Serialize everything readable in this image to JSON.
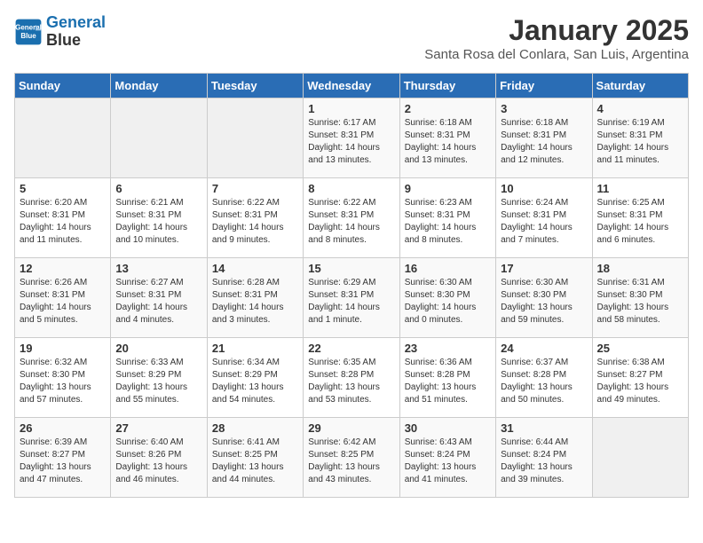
{
  "header": {
    "logo_line1": "General",
    "logo_line2": "Blue",
    "month": "January 2025",
    "location": "Santa Rosa del Conlara, San Luis, Argentina"
  },
  "days_of_week": [
    "Sunday",
    "Monday",
    "Tuesday",
    "Wednesday",
    "Thursday",
    "Friday",
    "Saturday"
  ],
  "weeks": [
    [
      {
        "day": "",
        "content": ""
      },
      {
        "day": "",
        "content": ""
      },
      {
        "day": "",
        "content": ""
      },
      {
        "day": "1",
        "content": "Sunrise: 6:17 AM\nSunset: 8:31 PM\nDaylight: 14 hours\nand 13 minutes."
      },
      {
        "day": "2",
        "content": "Sunrise: 6:18 AM\nSunset: 8:31 PM\nDaylight: 14 hours\nand 13 minutes."
      },
      {
        "day": "3",
        "content": "Sunrise: 6:18 AM\nSunset: 8:31 PM\nDaylight: 14 hours\nand 12 minutes."
      },
      {
        "day": "4",
        "content": "Sunrise: 6:19 AM\nSunset: 8:31 PM\nDaylight: 14 hours\nand 11 minutes."
      }
    ],
    [
      {
        "day": "5",
        "content": "Sunrise: 6:20 AM\nSunset: 8:31 PM\nDaylight: 14 hours\nand 11 minutes."
      },
      {
        "day": "6",
        "content": "Sunrise: 6:21 AM\nSunset: 8:31 PM\nDaylight: 14 hours\nand 10 minutes."
      },
      {
        "day": "7",
        "content": "Sunrise: 6:22 AM\nSunset: 8:31 PM\nDaylight: 14 hours\nand 9 minutes."
      },
      {
        "day": "8",
        "content": "Sunrise: 6:22 AM\nSunset: 8:31 PM\nDaylight: 14 hours\nand 8 minutes."
      },
      {
        "day": "9",
        "content": "Sunrise: 6:23 AM\nSunset: 8:31 PM\nDaylight: 14 hours\nand 8 minutes."
      },
      {
        "day": "10",
        "content": "Sunrise: 6:24 AM\nSunset: 8:31 PM\nDaylight: 14 hours\nand 7 minutes."
      },
      {
        "day": "11",
        "content": "Sunrise: 6:25 AM\nSunset: 8:31 PM\nDaylight: 14 hours\nand 6 minutes."
      }
    ],
    [
      {
        "day": "12",
        "content": "Sunrise: 6:26 AM\nSunset: 8:31 PM\nDaylight: 14 hours\nand 5 minutes."
      },
      {
        "day": "13",
        "content": "Sunrise: 6:27 AM\nSunset: 8:31 PM\nDaylight: 14 hours\nand 4 minutes."
      },
      {
        "day": "14",
        "content": "Sunrise: 6:28 AM\nSunset: 8:31 PM\nDaylight: 14 hours\nand 3 minutes."
      },
      {
        "day": "15",
        "content": "Sunrise: 6:29 AM\nSunset: 8:31 PM\nDaylight: 14 hours\nand 1 minute."
      },
      {
        "day": "16",
        "content": "Sunrise: 6:30 AM\nSunset: 8:30 PM\nDaylight: 14 hours\nand 0 minutes."
      },
      {
        "day": "17",
        "content": "Sunrise: 6:30 AM\nSunset: 8:30 PM\nDaylight: 13 hours\nand 59 minutes."
      },
      {
        "day": "18",
        "content": "Sunrise: 6:31 AM\nSunset: 8:30 PM\nDaylight: 13 hours\nand 58 minutes."
      }
    ],
    [
      {
        "day": "19",
        "content": "Sunrise: 6:32 AM\nSunset: 8:30 PM\nDaylight: 13 hours\nand 57 minutes."
      },
      {
        "day": "20",
        "content": "Sunrise: 6:33 AM\nSunset: 8:29 PM\nDaylight: 13 hours\nand 55 minutes."
      },
      {
        "day": "21",
        "content": "Sunrise: 6:34 AM\nSunset: 8:29 PM\nDaylight: 13 hours\nand 54 minutes."
      },
      {
        "day": "22",
        "content": "Sunrise: 6:35 AM\nSunset: 8:28 PM\nDaylight: 13 hours\nand 53 minutes."
      },
      {
        "day": "23",
        "content": "Sunrise: 6:36 AM\nSunset: 8:28 PM\nDaylight: 13 hours\nand 51 minutes."
      },
      {
        "day": "24",
        "content": "Sunrise: 6:37 AM\nSunset: 8:28 PM\nDaylight: 13 hours\nand 50 minutes."
      },
      {
        "day": "25",
        "content": "Sunrise: 6:38 AM\nSunset: 8:27 PM\nDaylight: 13 hours\nand 49 minutes."
      }
    ],
    [
      {
        "day": "26",
        "content": "Sunrise: 6:39 AM\nSunset: 8:27 PM\nDaylight: 13 hours\nand 47 minutes."
      },
      {
        "day": "27",
        "content": "Sunrise: 6:40 AM\nSunset: 8:26 PM\nDaylight: 13 hours\nand 46 minutes."
      },
      {
        "day": "28",
        "content": "Sunrise: 6:41 AM\nSunset: 8:25 PM\nDaylight: 13 hours\nand 44 minutes."
      },
      {
        "day": "29",
        "content": "Sunrise: 6:42 AM\nSunset: 8:25 PM\nDaylight: 13 hours\nand 43 minutes."
      },
      {
        "day": "30",
        "content": "Sunrise: 6:43 AM\nSunset: 8:24 PM\nDaylight: 13 hours\nand 41 minutes."
      },
      {
        "day": "31",
        "content": "Sunrise: 6:44 AM\nSunset: 8:24 PM\nDaylight: 13 hours\nand 39 minutes."
      },
      {
        "day": "",
        "content": ""
      }
    ]
  ]
}
